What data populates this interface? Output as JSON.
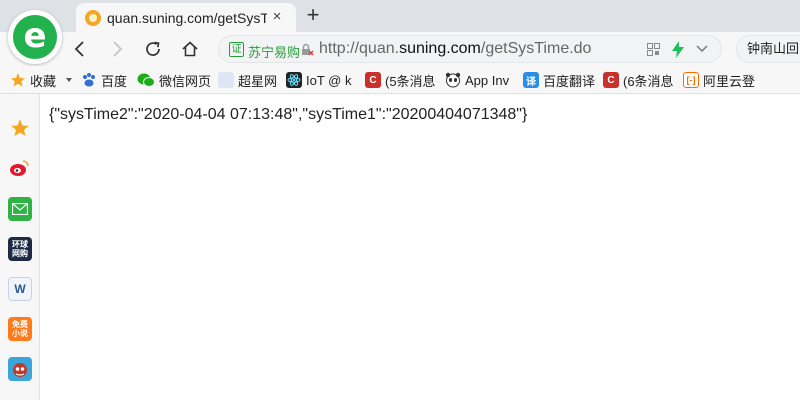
{
  "tab": {
    "title": "quan.suning.com/getSysTim",
    "close_label": "×",
    "new_tab_label": "+"
  },
  "address_bar": {
    "cert_label": "证",
    "site_name": "苏宁易购",
    "url_prefix": "http://quan.",
    "url_domain": "suning.com",
    "url_path": "/getSysTime.do"
  },
  "search": {
    "value": "钟南山回"
  },
  "bookmarks": [
    {
      "label": "收藏",
      "icon": "star-icon",
      "color": "#f5a623"
    },
    {
      "label": "百度",
      "icon": "baidu-paw-icon",
      "color": "#2f6fd6"
    },
    {
      "label": "微信网页",
      "icon": "wechat-icon",
      "color": "#1aad19"
    },
    {
      "label": "超星网",
      "icon": "blank-page-icon",
      "color": "#dde6f3"
    },
    {
      "label": "IoT @ k",
      "icon": "react-icon",
      "color": "#222222"
    },
    {
      "label": "(5条消息",
      "icon": "csdn-icon",
      "color": "#c9302c"
    },
    {
      "label": "App Inv",
      "icon": "panda-icon",
      "color": "#333333"
    },
    {
      "label": "百度翻译",
      "icon": "translate-icon",
      "color": "#2b8ee6"
    },
    {
      "label": "(6条消息",
      "icon": "csdn-icon",
      "color": "#c9302c"
    },
    {
      "label": "阿里云登",
      "icon": "aliyun-icon",
      "color": "#ff6a00"
    }
  ],
  "sidebar_items": [
    {
      "icon": "favorites-star-icon",
      "text": ""
    },
    {
      "icon": "weibo-icon",
      "text": ""
    },
    {
      "icon": "mail-icon",
      "text": ""
    },
    {
      "icon": "news-app-icon",
      "text": "环球 网购"
    },
    {
      "icon": "document-icon",
      "text": "W"
    },
    {
      "icon": "coupon-app-icon",
      "text": "免费 小说"
    },
    {
      "icon": "game-app-icon",
      "text": ""
    }
  ],
  "page": {
    "json_text": "{\"sysTime2\":\"2020-04-04 07:13:48\",\"sysTime1\":\"20200404071348\"}"
  },
  "colors": {
    "accent_green": "#22b14c",
    "secure_green": "#2a9d3a",
    "chrome_bg": "#f7f7f7",
    "tabstrip_bg": "#dee1e6"
  }
}
